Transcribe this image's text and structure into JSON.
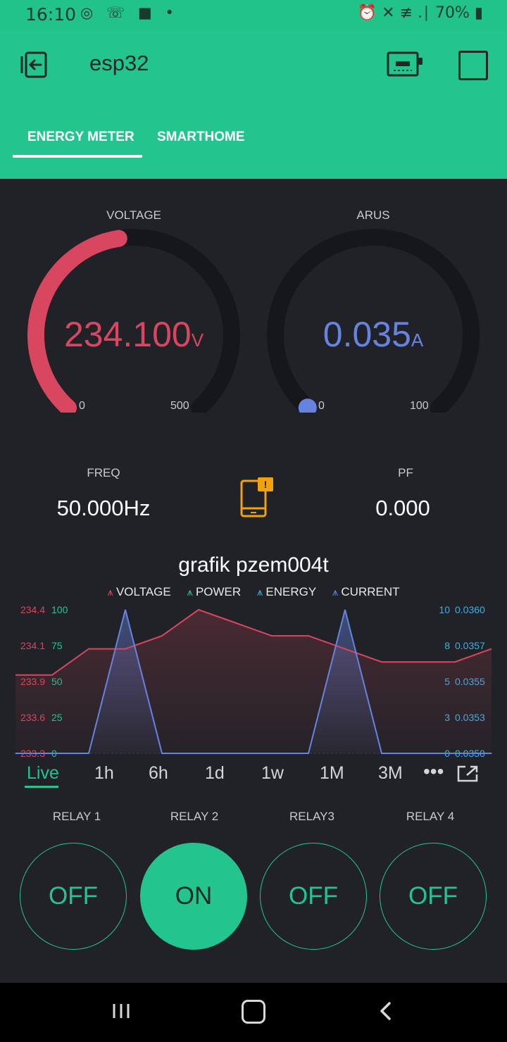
{
  "status_bar": {
    "time": "16:10",
    "left_icons": "◎ ☏ ■ •",
    "right_text": "⏰ ✕ ≢ .∣ 70% ▮"
  },
  "app_bar": {
    "title": "esp32",
    "accent_color": "#23c48e"
  },
  "tabs": [
    {
      "label": "ENERGY METER",
      "active": true
    },
    {
      "label": "SMARTHOME",
      "active": false
    }
  ],
  "gauges": {
    "voltage": {
      "label": "VOLTAGE",
      "value": "234.100",
      "unit": "V",
      "min": "0",
      "max": "500",
      "fraction": 0.4682,
      "color": "#d9465f"
    },
    "arus": {
      "label": "ARUS",
      "value": "0.035",
      "unit": "A",
      "min": "0",
      "max": "100",
      "fraction": 0.00035,
      "color": "#6683e0"
    }
  },
  "values": {
    "freq": {
      "label": "FREQ",
      "value": "50.000Hz"
    },
    "pf": {
      "label": "PF",
      "value": "0.000"
    },
    "device_status_icon": "phone-alert-icon"
  },
  "chart": {
    "title": "grafik pzem004t",
    "legend": [
      "VOLTAGE",
      "POWER",
      "ENERGY",
      "CURRENT"
    ],
    "left_axis_voltage": [
      "234.4",
      "234.1",
      "233.9",
      "233.6",
      "233.3"
    ],
    "left_axis_power": [
      "100",
      "75",
      "50",
      "25",
      "0"
    ],
    "right_axis_energy": [
      "10",
      "8",
      "5",
      "3",
      "0"
    ],
    "right_axis_current": [
      "0.0360",
      "0.0357",
      "0.0355",
      "0.0353",
      "0.0350"
    ],
    "ranges": [
      "Live",
      "1h",
      "6h",
      "1d",
      "1w",
      "1M",
      "3M"
    ],
    "active_range": "Live",
    "more_icon": "more-dots-icon",
    "export_icon": "export-icon"
  },
  "chart_data": {
    "type": "line",
    "title": "grafik pzem004t",
    "x": [
      0,
      1,
      2,
      3,
      4,
      5,
      6,
      7,
      8,
      9,
      10,
      11,
      12,
      13
    ],
    "series": [
      {
        "name": "VOLTAGE",
        "color": "#d9465f",
        "values": [
          233.9,
          233.9,
          234.1,
          234.1,
          234.2,
          234.4,
          234.3,
          234.2,
          234.2,
          234.1,
          234.0,
          234.0,
          234.0,
          234.1
        ]
      },
      {
        "name": "CURRENT",
        "color": "#6683e0",
        "values": [
          0.035,
          0.035,
          0.035,
          0.036,
          0.035,
          0.035,
          0.035,
          0.035,
          0.035,
          0.036,
          0.035,
          0.035,
          0.035,
          0.035
        ]
      },
      {
        "name": "POWER",
        "color": "#23c48e",
        "values": []
      },
      {
        "name": "ENERGY",
        "color": "#3bb0e6",
        "values": []
      }
    ],
    "ylim_left": [
      233.3,
      234.4
    ],
    "ylim_right": [
      0.035,
      0.036
    ],
    "grid": false
  },
  "relays": [
    {
      "label": "RELAY 1",
      "state": "OFF"
    },
    {
      "label": "RELAY 2",
      "state": "ON"
    },
    {
      "label": "RELAY3",
      "state": "OFF"
    },
    {
      "label": "RELAY 4",
      "state": "OFF"
    }
  ]
}
